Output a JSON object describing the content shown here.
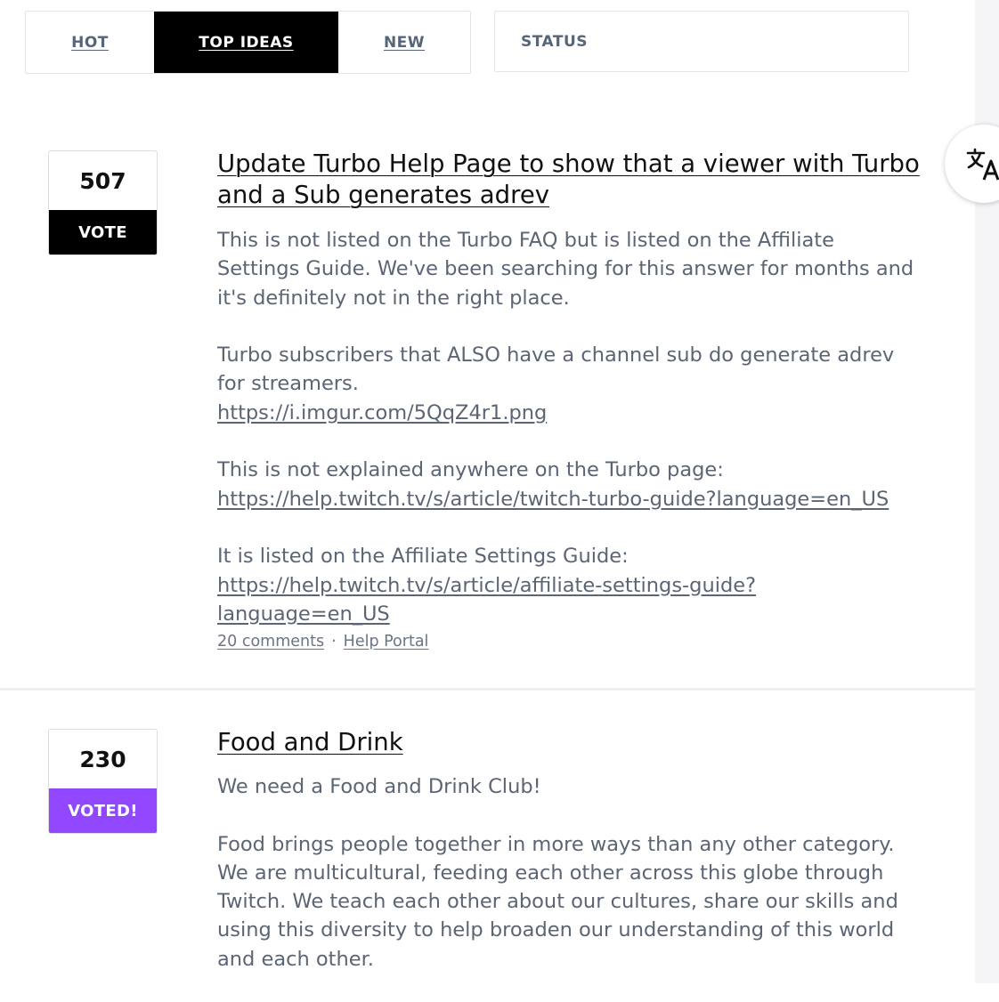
{
  "tabs": {
    "hot": "HOT",
    "top_ideas": "TOP IDEAS",
    "new": "NEW",
    "active": "TOP IDEAS"
  },
  "status_filter": {
    "label": "STATUS"
  },
  "translate_button": {
    "icon": "translate-icon"
  },
  "ideas": [
    {
      "votes": "507",
      "vote_label": "VOTE",
      "voted": false,
      "title": "Update Turbo Help Page to show that a viewer with Turbo and a Sub generates adrev",
      "body": {
        "p1": "This is not listed on the Turbo FAQ but is listed on the Affiliate Settings Guide. We've been searching for this answer for months and it's definitely not in the right place.",
        "p2_text": "Turbo subscribers that ALSO have a channel sub do generate adrev for streamers.",
        "p2_link": "https://i.imgur.com/5QqZ4r1.png",
        "p3_text": "This is not explained anywhere on the Turbo page:",
        "p3_link": "https://help.twitch.tv/s/article/twitch-turbo-guide?language=en_US",
        "p4_text": "It is listed on the Affiliate Settings Guide:",
        "p4_link": "https://help.twitch.tv/s/article/affiliate-settings-guide?language=en_US"
      },
      "comments": "20 comments",
      "separator": "·",
      "category": "Help Portal"
    },
    {
      "votes": "230",
      "vote_label": "VOTED!",
      "voted": true,
      "title": "Food and Drink",
      "body": {
        "p1": "We need a Food and Drink Club!",
        "p2": "Food brings people together in more ways than any other category. We are multicultural, feeding each other across this globe through Twitch. We teach each other about our cultures, share our skills and using this diversity to help broaden our understanding of this world and each other."
      }
    }
  ],
  "colors": {
    "tab_active_bg": "#000000",
    "vote_button": "#000000",
    "voted_button": "#9147ff",
    "body_text": "#5b6574",
    "title_text": "#111111"
  }
}
